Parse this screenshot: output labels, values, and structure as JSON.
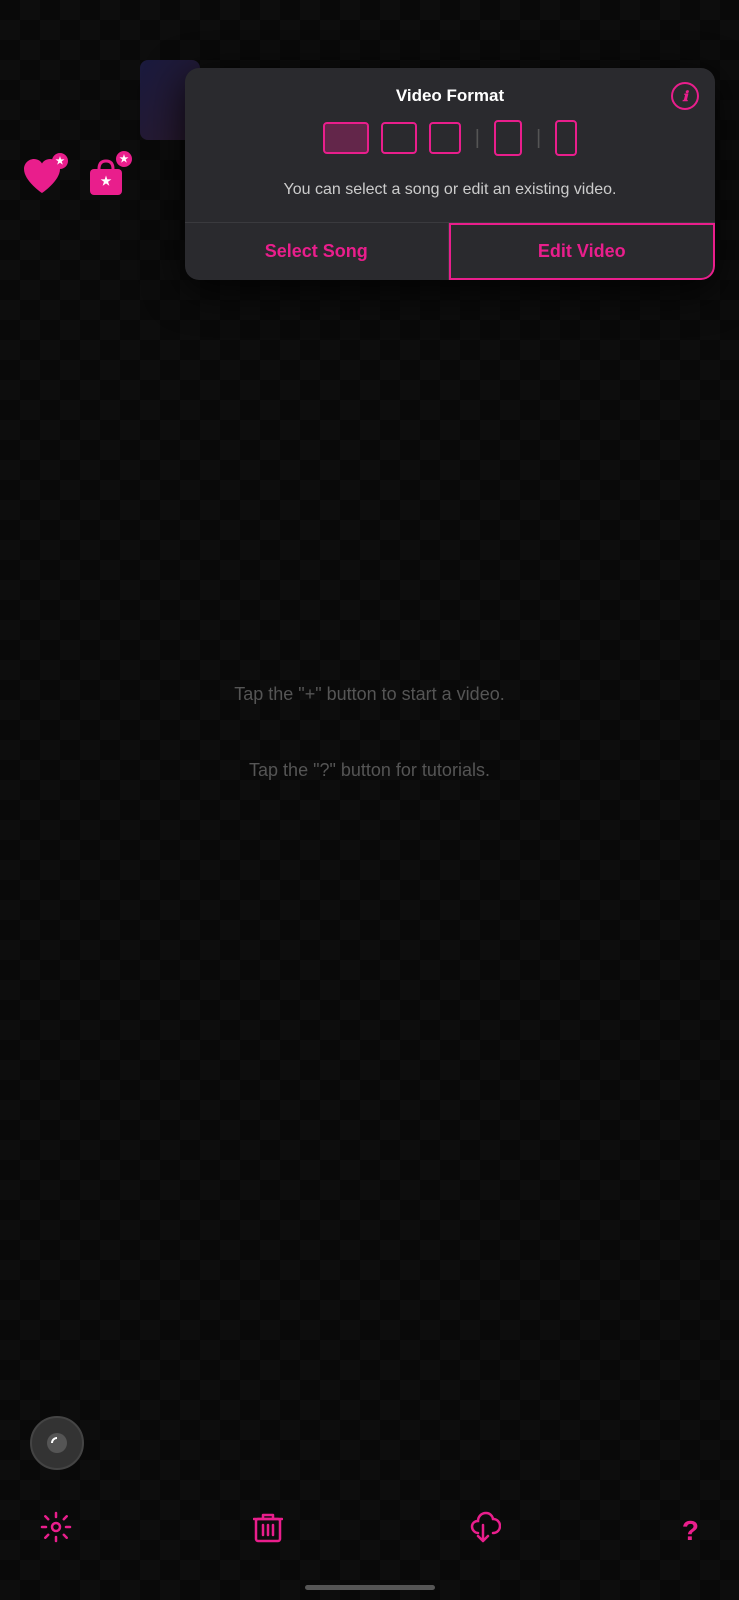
{
  "background": {
    "color": "#111"
  },
  "modal": {
    "title": "Video Format",
    "description": "You can select a song or edit an existing video.",
    "info_icon": "ℹ",
    "buttons": {
      "select_song": "Select Song",
      "edit_video": "Edit Video"
    },
    "formats": [
      {
        "label": "landscape",
        "active": true
      },
      {
        "label": "square-wide",
        "active": false
      },
      {
        "label": "square",
        "active": false
      },
      {
        "label": "portrait-mid",
        "active": false
      },
      {
        "label": "portrait",
        "active": false
      }
    ]
  },
  "hints": {
    "plus_hint": "Tap the \"+\" button to start a video.",
    "question_hint": "Tap the \"?\" button for tutorials."
  },
  "toolbar": {
    "settings_icon": "⚙",
    "delete_icon": "🗑",
    "download_icon": "⬇",
    "help_icon": "?"
  },
  "icons": {
    "heart": "♥",
    "bag": "🛍",
    "star": "★"
  }
}
